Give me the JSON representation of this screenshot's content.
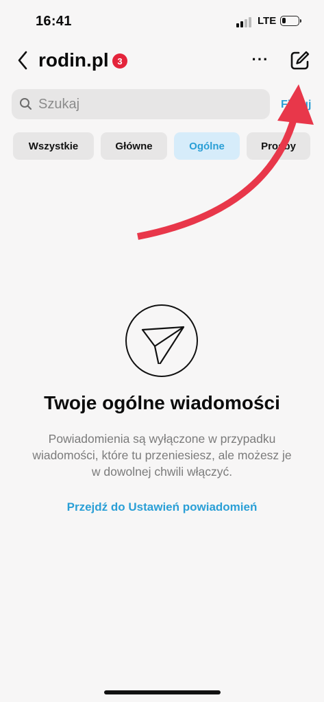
{
  "status_bar": {
    "time": "16:41",
    "network": "LTE"
  },
  "header": {
    "title": "rodin.pl",
    "badge": "3",
    "more_label": "···"
  },
  "search": {
    "placeholder": "Szukaj",
    "filter_label": "Filtruj"
  },
  "chips": [
    {
      "label": "Wszystkie"
    },
    {
      "label": "Główne"
    },
    {
      "label": "Ogólne",
      "active": true
    },
    {
      "label": "Prośby"
    }
  ],
  "empty_state": {
    "title": "Twoje ogólne wiadomości",
    "description": "Powiadomienia są wyłączone w przypadku wiadomości, które tu przeniesiesz, ale możesz je w dowolnej chwili włączyć.",
    "link": "Przejdź do Ustawień powiadomień"
  },
  "colors": {
    "accent": "#2a9fd6",
    "badge": "#e4243b",
    "arrow": "#e8374a"
  },
  "icons": [
    "back-chevron-icon",
    "more-icon",
    "compose-icon",
    "search-icon",
    "paper-plane-icon"
  ]
}
